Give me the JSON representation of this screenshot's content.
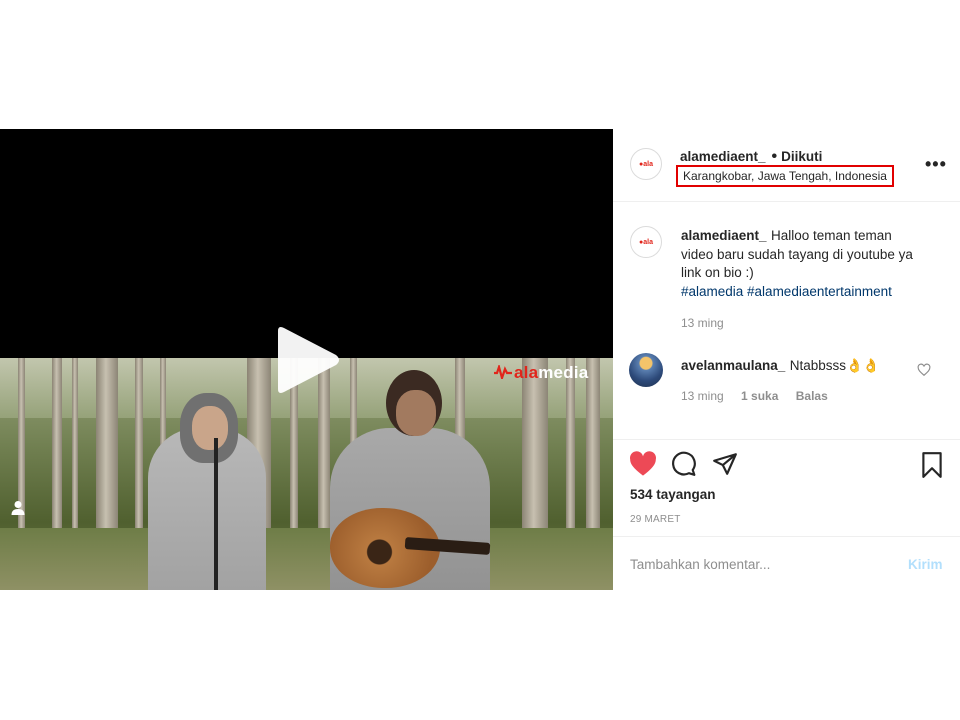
{
  "post": {
    "username": "alamediaent_",
    "separator": "•",
    "follow_status": "Diikuti",
    "location": "Karangkobar, Jawa Tengah, Indonesia",
    "more_icon": "more-horizontal-icon"
  },
  "media": {
    "watermark_a": "ala",
    "watermark_b": "media",
    "play_icon": "play-icon",
    "user_tag_icon": "user-tag-icon"
  },
  "caption": {
    "username": "alamediaent_",
    "text": "Halloo teman teman video baru sudah tayang di youtube ya link on bio :)",
    "hashtags": "#alamedia #alamediaentertainment",
    "time": "13 ming"
  },
  "comments": [
    {
      "username": "avelanmaulana_",
      "text": "Ntabbsss👌👌",
      "time": "13 ming",
      "likes": "1 suka",
      "reply": "Balas"
    }
  ],
  "actions": {
    "like_icon": "heart-icon",
    "comment_icon": "comment-icon",
    "share_icon": "share-icon",
    "save_icon": "bookmark-icon",
    "liked_color": "#ed4956"
  },
  "views": "534 tayangan",
  "date": "29 MARET",
  "comment_input": {
    "placeholder": "Tambahkan komentar...",
    "send_label": "Kirim"
  }
}
